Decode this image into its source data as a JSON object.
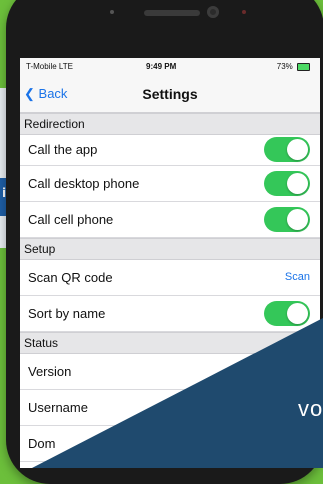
{
  "background": {
    "colors": {
      "green": "#6cbf3b",
      "navy": "#1f4a6e"
    },
    "left_strip_text": "is",
    "overlay_text": "vo"
  },
  "status_bar": {
    "carrier": "T-Mobile  LTE",
    "time": "9:49 PM",
    "battery": "73%"
  },
  "navbar": {
    "back_label": "Back",
    "title": "Settings"
  },
  "sections": {
    "redirection": "Redirection",
    "setup": "Setup",
    "status": "Status"
  },
  "rows": {
    "call_app": "Call the app",
    "call_desktop": "Call desktop phone",
    "call_cell": "Call cell phone",
    "scan_qr": "Scan QR code",
    "scan_action": "Scan",
    "sort_by_name": "Sort by name",
    "version": "Version",
    "username": "Username",
    "domain": "Dom"
  },
  "toggles": {
    "call_app": true,
    "call_desktop": true,
    "call_cell": true,
    "sort_by_name": true
  },
  "accent_color": "#1a73e8",
  "toggle_color": "#34c759"
}
